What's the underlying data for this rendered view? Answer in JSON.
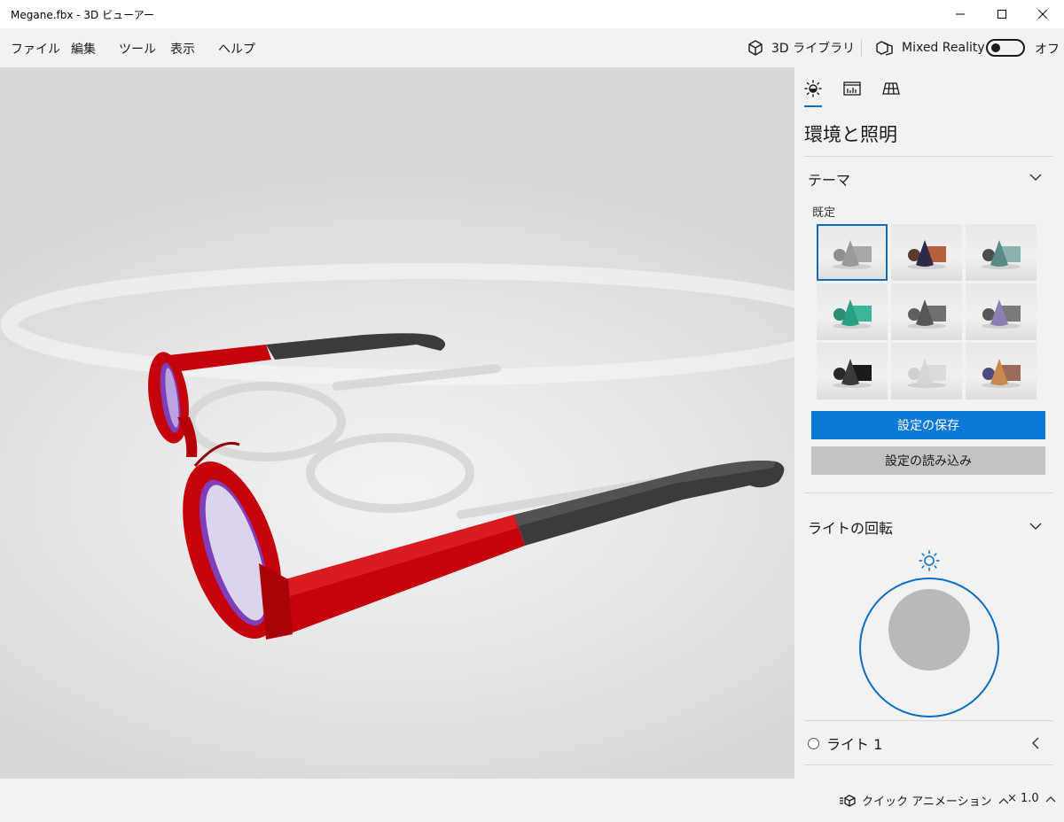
{
  "window": {
    "title": "Megane.fbx - 3D ビューアー"
  },
  "menu": {
    "file": "ファイル",
    "edit": "編集",
    "tools": "ツール",
    "view": "表示",
    "help": "ヘルプ"
  },
  "toolbar": {
    "library_label": "3D ライブラリ",
    "mixed_reality_label": "Mixed Reality",
    "mixed_reality_state": "オフ"
  },
  "panel": {
    "title": "環境と照明",
    "theme_section": {
      "header": "テーマ",
      "default_label": "既定"
    },
    "themes": [
      {
        "sphere": "#8f8f8f",
        "cone": "#9a9a9a",
        "box": "#a8a8a8",
        "selected": true
      },
      {
        "sphere": "#5a3a30",
        "cone": "#2d2a48",
        "box": "#b5603e",
        "selected": false
      },
      {
        "sphere": "#4d4d4d",
        "cone": "#5b8a86",
        "box": "#8ab3ad",
        "selected": false
      },
      {
        "sphere": "#2e8a73",
        "cone": "#27a083",
        "box": "#3bb596",
        "selected": false
      },
      {
        "sphere": "#606060",
        "cone": "#575757",
        "box": "#707070",
        "selected": false
      },
      {
        "sphere": "#575757",
        "cone": "#8a7fb0",
        "box": "#7a7a7a",
        "selected": false
      },
      {
        "sphere": "#2a2a2a",
        "cone": "#3a3a3a",
        "box": "#1a1a1a",
        "selected": false
      },
      {
        "sphere": "#cfcfcf",
        "cone": "#d6d6d6",
        "box": "#dcdcdc",
        "selected": false
      },
      {
        "sphere": "#4b4d7a",
        "cone": "#c98a4e",
        "box": "#9a6a5a",
        "selected": false
      }
    ],
    "save_button": "設定の保存",
    "load_button": "設定の読み込み",
    "light_rotation_header": "ライトの回転",
    "light_item": "ライト 1"
  },
  "statusbar": {
    "animation_label": "クイック アニメーション",
    "speed_label": "× 1.0"
  },
  "colors": {
    "accent": "#0a78d7",
    "frame": "#c4040a",
    "temples": "#3a3a3a"
  }
}
